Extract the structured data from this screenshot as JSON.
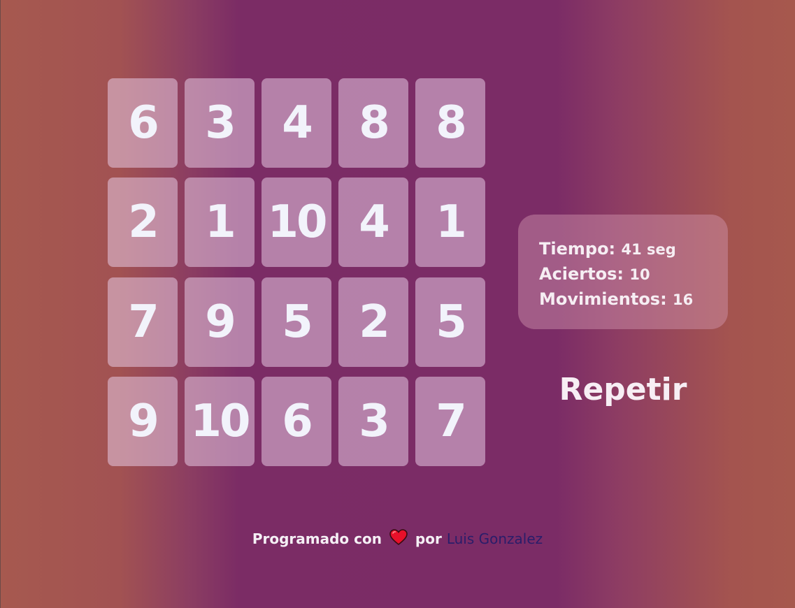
{
  "board": {
    "cards": [
      "6",
      "3",
      "4",
      "8",
      "8",
      "2",
      "1",
      "10",
      "4",
      "1",
      "7",
      "9",
      "5",
      "2",
      "5",
      "9",
      "10",
      "6",
      "3",
      "7"
    ]
  },
  "stats": {
    "time_label": "Tiempo:",
    "time_value": "41 seg",
    "hits_label": "Aciertos:",
    "hits_value": "10",
    "moves_label": "Movimientos:",
    "moves_value": "16"
  },
  "repeat_button": "Repetir",
  "footer": {
    "text_before": "Programado con",
    "heart_icon": "heart-icon",
    "text_after": "por",
    "author": "Luis Gonzalez"
  },
  "colors": {
    "card_text": "#f2f3fb",
    "author_link": "#2a1d6a",
    "heart": "#e8102a"
  }
}
